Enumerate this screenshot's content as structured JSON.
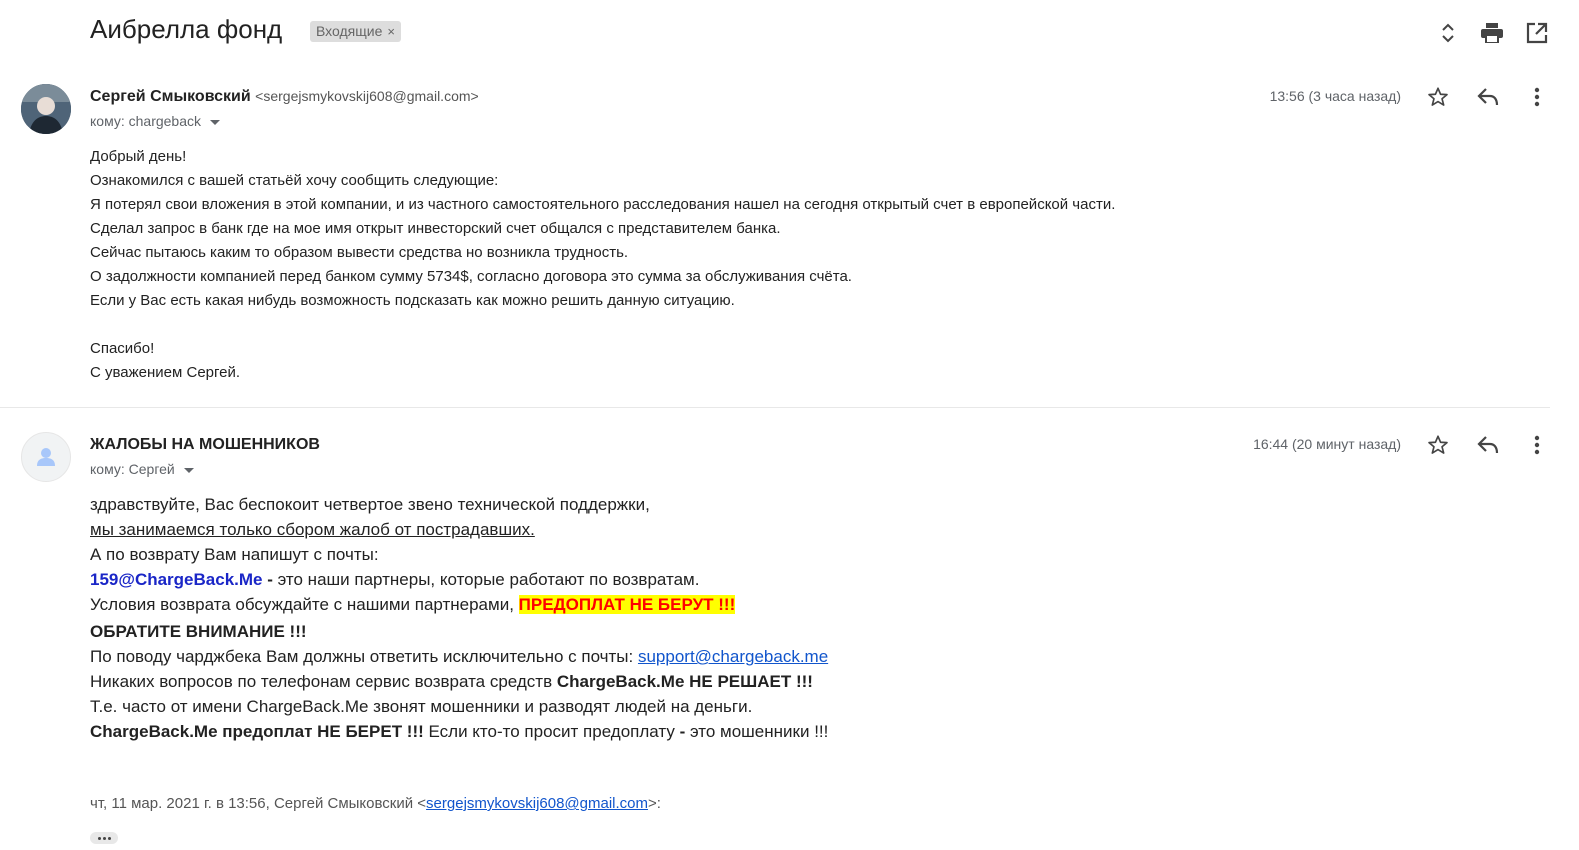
{
  "header": {
    "subject": "Аибрелла фонд",
    "label": "Входящие",
    "label_remove": "×"
  },
  "messages": [
    {
      "sender_name": "Сергей Смыковский",
      "sender_email": "<sergejsmykovskij608@gmail.com>",
      "to": "кому: chargeback",
      "time": "13:56 (3 часа назад)",
      "body": [
        "Добрый день!",
        "Ознакомился  с вашей статьёй хочу сообщить следующие:",
        "Я потерял свои вложения в этой компании, и из частного самостоятельного расследования нашел на сегодня открытый счет в европейской части.",
        "Сделал запрос в банк где на мое имя открыт инвесторский счет общался с представителем банка.",
        "Сейчас пытаюсь каким то образом вывести средства но возникла трудность.",
        "О задолжности компанией перед банком сумму 5734$, согласно договора это сумма за обслуживания счёта.",
        "Если у Вас есть какая нибудь возможность подсказать как можно решить данную ситуацию.",
        "",
        "Спасибо!",
        "С уважением Сергей."
      ]
    },
    {
      "sender_name": "ЖАЛОБЫ НА МОШЕННИКОВ",
      "to": "кому: Сергей",
      "time": "16:44 (20 минут назад)",
      "body": {
        "l1": "здравствуйте, Вас беспокоит четвертое звено технической поддержки,",
        "l2": "мы занимаемся только сбором жалоб от пострадавших.",
        "l3": "А по возврату Вам напишут с почты:",
        "l4_email": "159@ChargeBack.Me",
        "l4_dash": " - ",
        "l4_rest": "это наши партнеры, которые работают по возвратам.",
        "l5_text": "Условия возврата обсуждайте с нашими партнерами, ",
        "l5_highlight": "ПРЕДОПЛАТ НЕ БЕРУТ !!!",
        "l6": "ОБРАТИТЕ ВНИМАНИЕ !!!",
        "l7_text": "По поводу чарджбека Вам должны ответить исключительно с почты: ",
        "l7_link": "support@chargeback.me",
        "l8_text": "Никаких вопросов по телефонам сервис возврата средств ",
        "l8_bold": "ChargeBack.Me НЕ РЕШАЕТ !!!",
        "l9": "Т.е. часто от имени ChargeBack.Me звонят мошенники и разводят людей на деньги.",
        "l10_bold": "ChargeBack.Me предоплат НЕ БЕРЕТ !!!",
        "l10_text": " Если кто-то просит предоплату ",
        "l10_dash": "-",
        "l10_end": " это мошенники !!!"
      },
      "quote": {
        "prefix": "чт, 11 мар. 2021 г. в 13:56, Сергей Смыковский <",
        "email": "sergejsmykovskij608@gmail.com",
        "suffix": ">:"
      }
    }
  ],
  "icons": {
    "header": [
      "expand-collapse-icon",
      "print-icon",
      "open-new-window-icon"
    ],
    "message": [
      "star-icon",
      "reply-icon",
      "more-vert-icon"
    ],
    "ellipsis": "show-trimmed-content-icon"
  }
}
